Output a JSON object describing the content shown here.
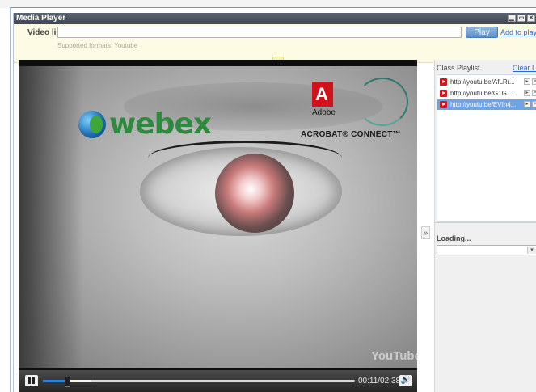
{
  "window": {
    "title": "Media Player",
    "controls": [
      "minimize-icon",
      "restore-icon",
      "close-icon"
    ]
  },
  "link_bar": {
    "label": "Video link:",
    "input_value": "",
    "play_label": "Play",
    "add_label": "Add to playlist",
    "formats": "Supported formats: Youtube",
    "collapse_icon": "double-chevron-up-icon"
  },
  "video": {
    "watermark": "YouTube",
    "overlay_brands": [
      "webex",
      "Adobe",
      "ACROBAT® CONNECT™"
    ],
    "controls": {
      "state_icon": "pause-icon",
      "time": "00:11/02:38",
      "progress_fraction": 0.07,
      "volume_icon": "speaker-icon"
    }
  },
  "playlist": {
    "header": "Class Playlist",
    "clear_label": "Clear List",
    "items": [
      {
        "url": "http://youtu.be/AfLRr...",
        "active": false
      },
      {
        "url": "http://youtu.be/G1G...",
        "active": false
      },
      {
        "url": "http://youtu.be/EVIn4...",
        "active": true
      }
    ]
  },
  "loading": {
    "label": "Loading...",
    "select_value": ""
  },
  "colors": {
    "titlebar": "#4a525c",
    "link_bar_bg": "#fdfbe4",
    "play_button": "#6f9fd8",
    "active_item": "#6fa3e6",
    "progress": "#2f7fd8"
  }
}
